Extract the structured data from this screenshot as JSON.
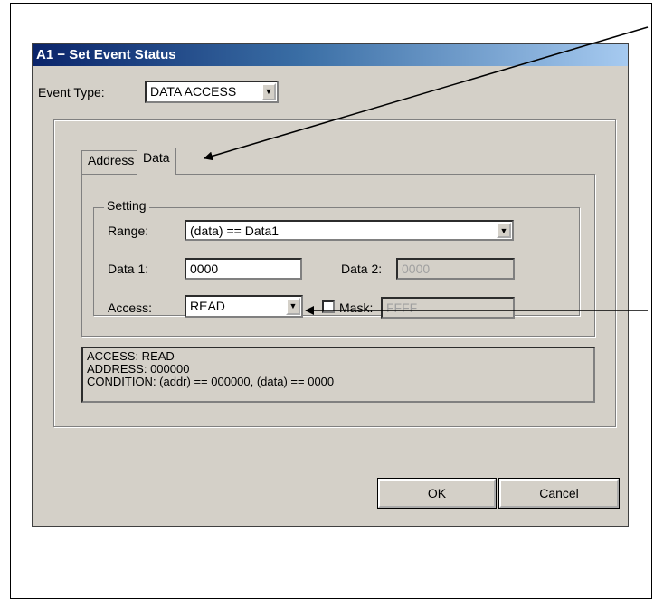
{
  "dialog": {
    "title": "A1 − Set Event Status",
    "event_type_label": "Event Type:",
    "event_type_value": "DATA ACCESS",
    "tabs": [
      {
        "label": "Address"
      },
      {
        "label": "Data"
      }
    ],
    "setting": {
      "group_label": "Setting",
      "range_label": "Range:",
      "range_value": "(data) == Data1",
      "data1_label": "Data 1:",
      "data1_value": "0000",
      "data2_label": "Data 2:",
      "data2_value": "0000",
      "access_label": "Access:",
      "access_value": "READ",
      "mask_label": "Mask:",
      "mask_value": "FFFF"
    },
    "status_lines": [
      "ACCESS: READ",
      "ADDRESS: 000000",
      "CONDITION: (addr) == 000000, (data) == 0000"
    ],
    "ok_label": "OK",
    "cancel_label": "Cancel"
  }
}
